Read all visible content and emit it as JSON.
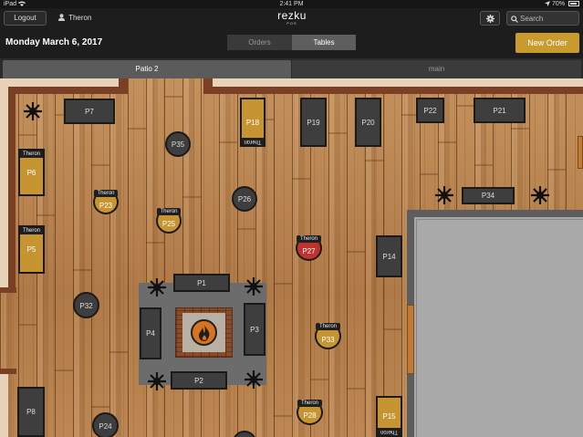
{
  "status_bar": {
    "device": "iPad",
    "wifi_icon": "wifi-icon",
    "time": "2:41 PM",
    "battery": "70%"
  },
  "topbar": {
    "logout_label": "Logout",
    "user_name": "Theron",
    "brand_name": "rezku",
    "brand_sub": "POS",
    "search_placeholder": "Search"
  },
  "header": {
    "date": "Monday March 6, 2017",
    "tabs": [
      {
        "label": "Orders",
        "active": false
      },
      {
        "label": "Tables",
        "active": true
      }
    ],
    "new_order_label": "New Order"
  },
  "rooms": [
    {
      "label": "Patio 2",
      "active": true
    },
    {
      "label": "main",
      "active": false
    }
  ],
  "colors": {
    "occupied": "#c69531",
    "free": "#3e3e3e",
    "alert": "#c0322e",
    "accent": "#c89b2e"
  },
  "tables": {
    "P7": {
      "label": "P7"
    },
    "P18": {
      "label": "P18",
      "server": "Theron"
    },
    "P19": {
      "label": "P19"
    },
    "P20": {
      "label": "P20"
    },
    "P22": {
      "label": "P22"
    },
    "P21": {
      "label": "P21"
    },
    "P6": {
      "label": "P6",
      "server": "Theron"
    },
    "P5": {
      "label": "P5",
      "server": "Theron"
    },
    "P35": {
      "label": "P35"
    },
    "P23": {
      "label": "P23",
      "server": "Theron"
    },
    "P25": {
      "label": "P25",
      "server": "Theron"
    },
    "P26": {
      "label": "P26"
    },
    "P34": {
      "label": "P34"
    },
    "P27": {
      "label": "P27",
      "server": "Theron"
    },
    "P14": {
      "label": "P14"
    },
    "P1": {
      "label": "P1"
    },
    "P4": {
      "label": "P4"
    },
    "P3": {
      "label": "P3"
    },
    "P2": {
      "label": "P2"
    },
    "P32": {
      "label": "P32"
    },
    "P33": {
      "label": "P33",
      "server": "Theron"
    },
    "P8": {
      "label": "P8"
    },
    "P24": {
      "label": "P24"
    },
    "P28": {
      "label": "P28",
      "server": "Theron"
    },
    "P15": {
      "label": "P15",
      "server": "Theron"
    }
  }
}
